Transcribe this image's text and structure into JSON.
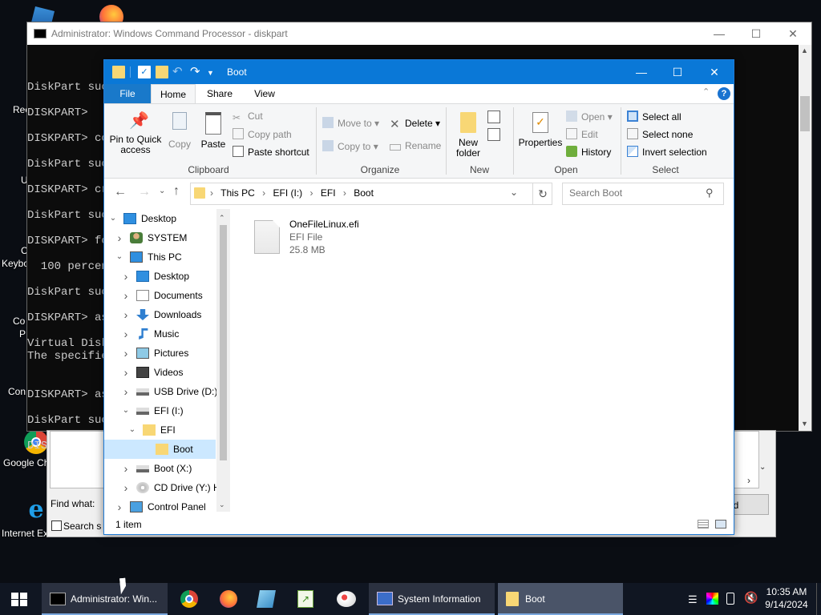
{
  "desktop": {
    "icons": [
      {
        "label": "Google Ch",
        "name": "google-chrome-desktop-icon"
      },
      {
        "label": "Internet Ex",
        "name": "internet-explorer-desktop-icon"
      }
    ],
    "partial_labels": [
      "Rec",
      "U",
      "C",
      "Keybo",
      "Co",
      "P",
      "Con"
    ]
  },
  "cmd": {
    "title": "Administrator: Windows Command Processor - diskpart",
    "lines": [
      "DiskPart suc",
      "DISKPART>",
      "DISKPART> co",
      "DiskPart suc",
      "DISKPART> cr",
      "DiskPart suc",
      "DISKPART> fo",
      "  100 percen",
      "DiskPart suc",
      "DISKPART> as",
      "Virtual Disk",
      "The specifie",
      "DISKPART> as",
      "DiskPart suc",
      "DISKPART>"
    ]
  },
  "find_dialog": {
    "find_what_label": "Find what:",
    "search_label": "Search s",
    "button_partial": "nd"
  },
  "explorer": {
    "title": "Boot",
    "tabs": [
      "File",
      "Home",
      "Share",
      "View"
    ],
    "active_tab": "Home",
    "ribbon": {
      "clipboard": {
        "pin_label": "Pin to Quick access",
        "copy_label": "Copy",
        "paste_label": "Paste",
        "cut_label": "Cut",
        "copy_path_label": "Copy path",
        "paste_shortcut_label": "Paste shortcut",
        "group_label": "Clipboard"
      },
      "organize": {
        "move_to_label": "Move to",
        "copy_to_label": "Copy to",
        "delete_label": "Delete",
        "rename_label": "Rename",
        "group_label": "Organize"
      },
      "new": {
        "new_folder_label": "New folder",
        "group_label": "New"
      },
      "open": {
        "properties_label": "Properties",
        "open_label": "Open",
        "edit_label": "Edit",
        "history_label": "History",
        "group_label": "Open"
      },
      "select": {
        "select_all_label": "Select all",
        "select_none_label": "Select none",
        "invert_label": "Invert selection",
        "group_label": "Select"
      }
    },
    "address": {
      "crumbs": [
        "This PC",
        "EFI (I:)",
        "EFI",
        "Boot"
      ],
      "search_placeholder": "Search Boot"
    },
    "nav": [
      {
        "label": "Desktop",
        "level": 0,
        "chev": "down",
        "icon": "desktop"
      },
      {
        "label": "SYSTEM",
        "level": 1,
        "chev": "right",
        "icon": "user"
      },
      {
        "label": "This PC",
        "level": 1,
        "chev": "down",
        "icon": "pc"
      },
      {
        "label": "Desktop",
        "level": 2,
        "chev": "right",
        "icon": "desktop"
      },
      {
        "label": "Documents",
        "level": 2,
        "chev": "right",
        "icon": "doc"
      },
      {
        "label": "Downloads",
        "level": 2,
        "chev": "right",
        "icon": "download"
      },
      {
        "label": "Music",
        "level": 2,
        "chev": "right",
        "icon": "music"
      },
      {
        "label": "Pictures",
        "level": 2,
        "chev": "right",
        "icon": "pic"
      },
      {
        "label": "Videos",
        "level": 2,
        "chev": "right",
        "icon": "video"
      },
      {
        "label": "USB Drive (D:)",
        "level": 2,
        "chev": "right",
        "icon": "drive"
      },
      {
        "label": "EFI (I:)",
        "level": 2,
        "chev": "down",
        "icon": "drive"
      },
      {
        "label": "EFI",
        "level": 3,
        "chev": "down",
        "icon": "folder"
      },
      {
        "label": "Boot",
        "level": 4,
        "chev": "",
        "icon": "folder",
        "selected": true
      },
      {
        "label": "Boot (X:)",
        "level": 2,
        "chev": "right",
        "icon": "drive"
      },
      {
        "label": "CD Drive (Y:) H",
        "level": 2,
        "chev": "right",
        "icon": "cd"
      },
      {
        "label": "Control Panel",
        "level": 1,
        "chev": "right",
        "icon": "cp"
      }
    ],
    "files": [
      {
        "name": "OneFileLinux.efi",
        "type": "EFI File",
        "size": "25.8 MB"
      }
    ],
    "status": "1 item"
  },
  "taskbar": {
    "items": [
      {
        "label": "Administrator: Win...",
        "name": "taskbar-cmd"
      },
      {
        "label": "System Information",
        "name": "taskbar-system-information"
      },
      {
        "label": "Boot",
        "name": "taskbar-boot"
      }
    ],
    "time": "10:35 AM",
    "date": "9/14/2024"
  }
}
